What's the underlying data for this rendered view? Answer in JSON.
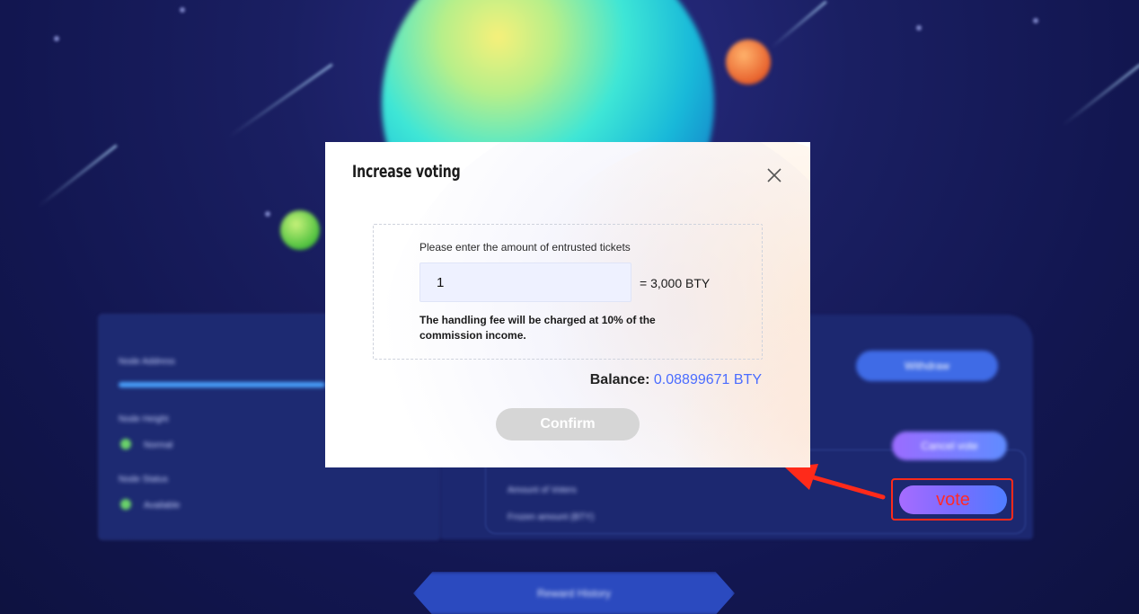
{
  "modal": {
    "title": "Increase voting",
    "entry_label": "Please enter the amount of entrusted tickets",
    "amount_value": "1",
    "equals_text": "= 3,000 BTY",
    "fee_note": "The handling fee will be charged at 10% of the commission income.",
    "balance_label": "Balance:",
    "balance_value": "0.08899671 BTY",
    "confirm_label": "Confirm",
    "close_icon": "close-icon"
  },
  "background": {
    "vote_button_label": "vote",
    "withdraw_label": "Withdraw",
    "cancel_label": "Cancel vote",
    "reward_label": "Reward History",
    "left_panel": {
      "node_address_label": "Node Address",
      "node_height_label": "Node Height",
      "node_height_value": "Normal",
      "node_status_label": "Node Status",
      "node_status_value": "Available"
    },
    "right_panel": {
      "row1": "Amount of Voters",
      "row2": "Frozen amount (BTY)"
    }
  },
  "colors": {
    "accent_blue": "#4a6cff",
    "annotation_red": "#ff2a1a",
    "confirm_disabled": "#d6d6d6"
  }
}
